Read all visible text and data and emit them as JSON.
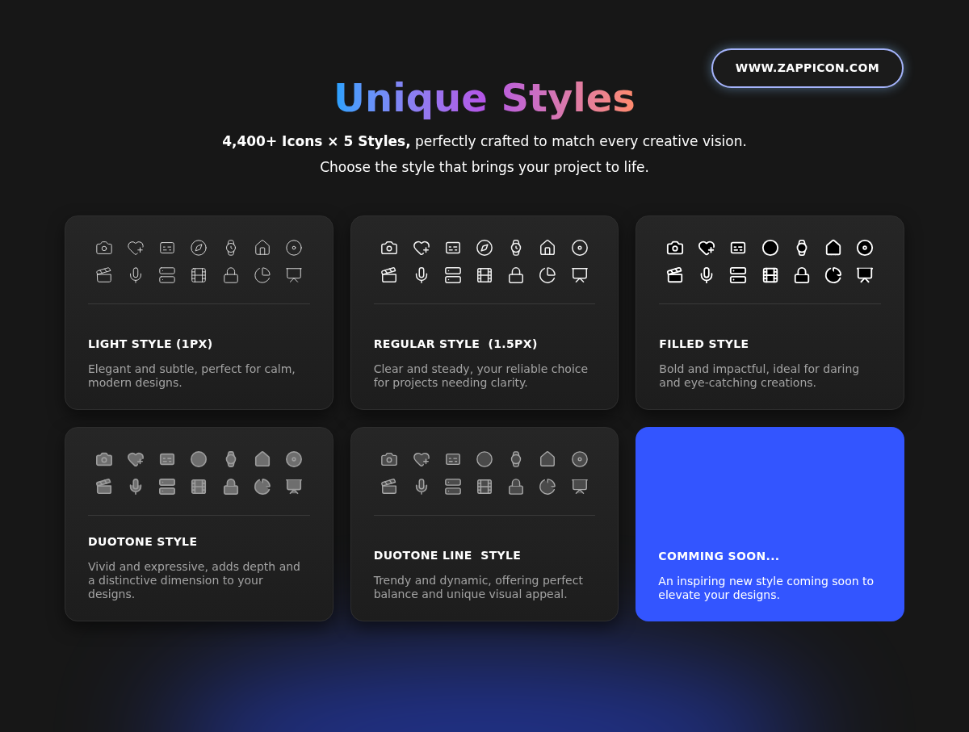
{
  "site_link": "WWW.ZAPPICON.COM",
  "title": "Unique Styles",
  "subtitle_lines": [
    "**4,400+ Icons × 5 Styles,** perfectly crafted to match every creative vision.",
    "Choose the style that brings your project to life."
  ],
  "cards": [
    {
      "kind": "light",
      "title": "LIGHT STYLE (1PX)",
      "description": "Elegant and subtle, perfect for calm, modern designs."
    },
    {
      "kind": "regular",
      "title": "REGULAR STYLE  (1.5PX)",
      "description": "Clear and steady, your reliable choice for projects needing clarity."
    },
    {
      "kind": "filled",
      "title": "FILLED STYLE",
      "description": "Bold and impactful, ideal for daring and eye-catching creations."
    },
    {
      "kind": "duotone",
      "title": "DUOTONE STYLE",
      "description": "Vivid and expressive, adds depth and a distinctive dimension to your designs."
    },
    {
      "kind": "duotone_line",
      "title": "DUOTONE LINE  STYLE",
      "description": "Trendy and dynamic, offering perfect balance and unique visual appeal."
    },
    {
      "kind": "coming_soon",
      "title": "COMMING SOON...",
      "description": "An inspiring new style coming soon to elevate your designs."
    }
  ]
}
